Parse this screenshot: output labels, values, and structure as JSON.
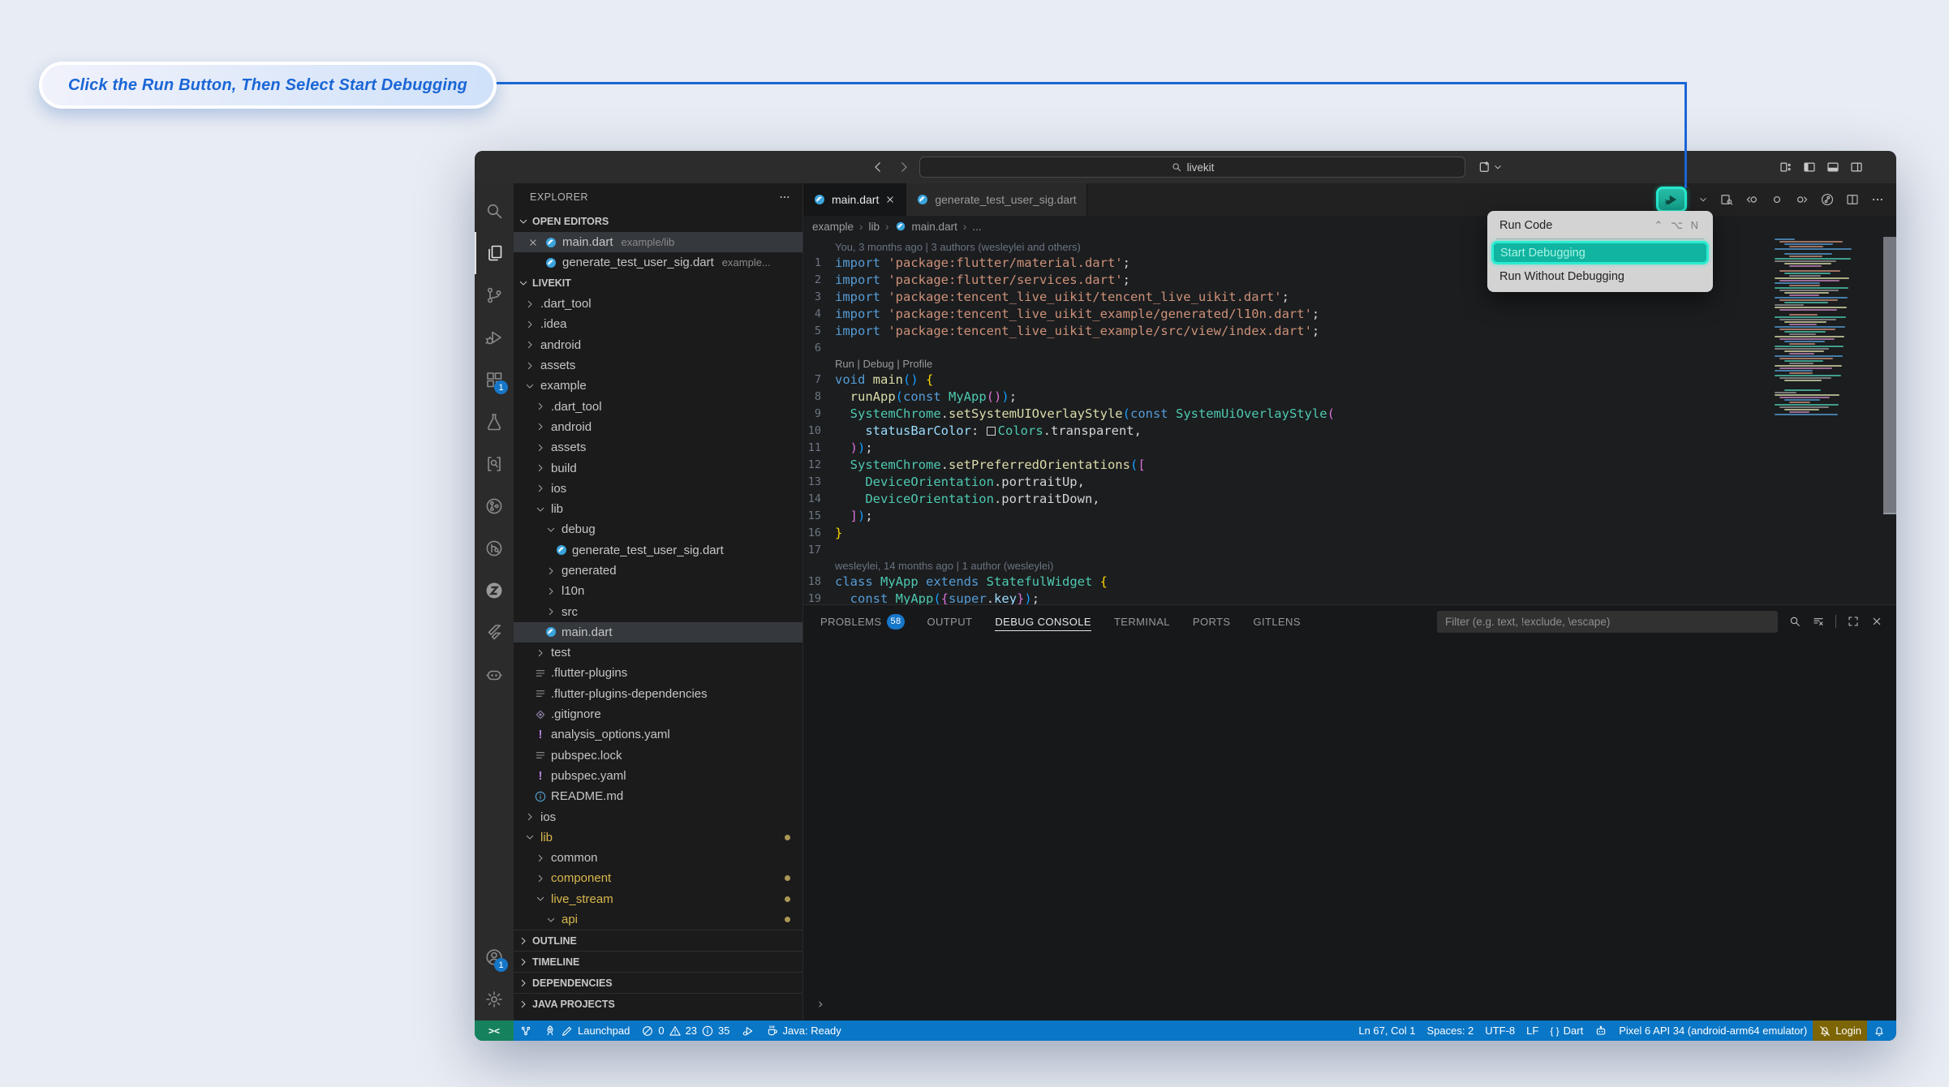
{
  "callout": {
    "text": "Click the Run Button, Then Select Start Debugging"
  },
  "titlebar": {
    "search_value": "livekit"
  },
  "activity_bar": {
    "items": [
      {
        "name": "search",
        "icon": "search"
      },
      {
        "name": "explorer",
        "icon": "files",
        "active": true
      },
      {
        "name": "source-control",
        "icon": "scm"
      },
      {
        "name": "run-and-debug",
        "icon": "debug"
      },
      {
        "name": "extensions",
        "icon": "extensions",
        "badge": "1"
      },
      {
        "name": "testing",
        "icon": "beaker"
      },
      {
        "name": "commit-search",
        "icon": "bracket-search"
      },
      {
        "name": "gitlens",
        "icon": "gitlens"
      },
      {
        "name": "gitlens-inspect",
        "icon": "gitlens-inspect"
      },
      {
        "name": "extension-z",
        "icon": "circle-z"
      },
      {
        "name": "flutter",
        "icon": "flutter"
      },
      {
        "name": "ai-assistant",
        "icon": "copilot"
      }
    ],
    "bottom_items": [
      {
        "name": "accounts",
        "icon": "account",
        "badge": "1"
      },
      {
        "name": "settings",
        "icon": "gear"
      }
    ]
  },
  "sidebar": {
    "title": "EXPLORER",
    "open_editors_label": "OPEN EDITORS",
    "open_editors": [
      {
        "name": "main.dart",
        "detail": "example/lib",
        "active": true
      },
      {
        "name": "generate_test_user_sig.dart",
        "detail": "example..."
      }
    ],
    "project_label": "LIVEKIT",
    "tree": [
      {
        "label": ".dart_tool",
        "indent": 0,
        "chev": "r"
      },
      {
        "label": ".idea",
        "indent": 0,
        "chev": "r"
      },
      {
        "label": "android",
        "indent": 0,
        "chev": "r"
      },
      {
        "label": "assets",
        "indent": 0,
        "chev": "r"
      },
      {
        "label": "example",
        "indent": 0,
        "chev": "d"
      },
      {
        "label": ".dart_tool",
        "indent": 1,
        "chev": "r"
      },
      {
        "label": "android",
        "indent": 1,
        "chev": "r"
      },
      {
        "label": "assets",
        "indent": 1,
        "chev": "r"
      },
      {
        "label": "build",
        "indent": 1,
        "chev": "r"
      },
      {
        "label": "ios",
        "indent": 1,
        "chev": "r"
      },
      {
        "label": "lib",
        "indent": 1,
        "chev": "d"
      },
      {
        "label": "debug",
        "indent": 2,
        "chev": "d"
      },
      {
        "label": "generate_test_user_sig.dart",
        "indent": 3,
        "icon": "dart"
      },
      {
        "label": "generated",
        "indent": 2,
        "chev": "r"
      },
      {
        "label": "l10n",
        "indent": 2,
        "chev": "r"
      },
      {
        "label": "src",
        "indent": 2,
        "chev": "r"
      },
      {
        "label": "main.dart",
        "indent": 2,
        "icon": "dart",
        "selected": true
      },
      {
        "label": "test",
        "indent": 1,
        "chev": "r"
      },
      {
        "label": ".flutter-plugins",
        "indent": 1,
        "icon": "list"
      },
      {
        "label": ".flutter-plugins-dependencies",
        "indent": 1,
        "icon": "list"
      },
      {
        "label": ".gitignore",
        "indent": 1,
        "icon": "git"
      },
      {
        "label": "analysis_options.yaml",
        "indent": 1,
        "icon": "yaml"
      },
      {
        "label": "pubspec.lock",
        "indent": 1,
        "icon": "list"
      },
      {
        "label": "pubspec.yaml",
        "indent": 1,
        "icon": "yaml"
      },
      {
        "label": "README.md",
        "indent": 1,
        "icon": "info"
      },
      {
        "label": "ios",
        "indent": 0,
        "chev": "r"
      },
      {
        "label": "lib",
        "indent": 0,
        "chev": "d",
        "mod": true,
        "dot": true
      },
      {
        "label": "common",
        "indent": 1,
        "chev": "r"
      },
      {
        "label": "component",
        "indent": 1,
        "chev": "r",
        "mod": true,
        "dot": true
      },
      {
        "label": "live_stream",
        "indent": 1,
        "chev": "d",
        "mod": true,
        "dot": true
      },
      {
        "label": "api",
        "indent": 2,
        "chev": "d",
        "mod": true,
        "dot": true
      }
    ],
    "bottom_sections": [
      "OUTLINE",
      "TIMELINE",
      "DEPENDENCIES",
      "JAVA PROJECTS"
    ]
  },
  "editor": {
    "tabs": [
      {
        "label": "main.dart",
        "active": true
      },
      {
        "label": "generate_test_user_sig.dart",
        "active": false
      }
    ],
    "breadcrumb": [
      "example",
      "lib",
      "main.dart",
      "..."
    ],
    "rows": [
      {
        "type": "blame",
        "text": "You, 3 months ago | 3 authors (wesleylei and others)"
      },
      {
        "type": "code",
        "n": "1",
        "tokens": [
          [
            "k",
            "import "
          ],
          [
            "s",
            "'package:flutter/material.dart'"
          ],
          [
            "p",
            ";"
          ]
        ]
      },
      {
        "type": "code",
        "n": "2",
        "tokens": [
          [
            "k",
            "import "
          ],
          [
            "s",
            "'package:flutter/services.dart'"
          ],
          [
            "p",
            ";"
          ]
        ]
      },
      {
        "type": "code",
        "n": "3",
        "tokens": [
          [
            "k",
            "import "
          ],
          [
            "s",
            "'package:tencent_live_uikit/tencent_live_uikit.dart'"
          ],
          [
            "p",
            ";"
          ]
        ]
      },
      {
        "type": "code",
        "n": "4",
        "tokens": [
          [
            "k",
            "import "
          ],
          [
            "s",
            "'package:tencent_live_uikit_example/generated/l10n.dart'"
          ],
          [
            "p",
            ";"
          ]
        ]
      },
      {
        "type": "code",
        "n": "5",
        "tokens": [
          [
            "k",
            "import "
          ],
          [
            "s",
            "'package:tencent_live_uikit_example/src/view/index.dart'"
          ],
          [
            "p",
            ";"
          ]
        ]
      },
      {
        "type": "code",
        "n": "6",
        "tokens": []
      },
      {
        "type": "lens",
        "text": "Run | Debug | Profile"
      },
      {
        "type": "code",
        "n": "7",
        "tokens": [
          [
            "k",
            "void "
          ],
          [
            "f",
            "main"
          ],
          [
            "b3",
            "()"
          ],
          [
            "p",
            " "
          ],
          [
            "b1",
            "{"
          ]
        ]
      },
      {
        "type": "code",
        "n": "8",
        "tokens": [
          [
            "p",
            "  "
          ],
          [
            "f",
            "runApp"
          ],
          [
            "b3",
            "("
          ],
          [
            "k",
            "const "
          ],
          [
            "t",
            "MyApp"
          ],
          [
            "b2",
            "()"
          ],
          [
            "b3",
            ")"
          ],
          [
            "p",
            ";"
          ]
        ]
      },
      {
        "type": "code",
        "n": "9",
        "tokens": [
          [
            "p",
            "  "
          ],
          [
            "t",
            "SystemChrome"
          ],
          [
            "p",
            "."
          ],
          [
            "f",
            "setSystemUIOverlayStyle"
          ],
          [
            "b3",
            "("
          ],
          [
            "k",
            "const "
          ],
          [
            "t",
            "SystemUiOverlayStyle"
          ],
          [
            "b2",
            "("
          ]
        ]
      },
      {
        "type": "code",
        "n": "10",
        "tokens": [
          [
            "p",
            "    "
          ],
          [
            "v",
            "statusBarColor"
          ],
          [
            "p",
            ": "
          ],
          [
            "w",
            ""
          ],
          [
            "t",
            "Colors"
          ],
          [
            "p",
            ".transparent,"
          ]
        ]
      },
      {
        "type": "code",
        "n": "11",
        "tokens": [
          [
            "p",
            "  "
          ],
          [
            "b2",
            ")"
          ],
          [
            "b3",
            ")"
          ],
          [
            "p",
            ";"
          ]
        ]
      },
      {
        "type": "code",
        "n": "12",
        "tokens": [
          [
            "p",
            "  "
          ],
          [
            "t",
            "SystemChrome"
          ],
          [
            "p",
            "."
          ],
          [
            "f",
            "setPreferredOrientations"
          ],
          [
            "b3",
            "("
          ],
          [
            "b2",
            "["
          ]
        ]
      },
      {
        "type": "code",
        "n": "13",
        "tokens": [
          [
            "p",
            "    "
          ],
          [
            "t",
            "DeviceOrientation"
          ],
          [
            "p",
            ".portraitUp,"
          ]
        ]
      },
      {
        "type": "code",
        "n": "14",
        "tokens": [
          [
            "p",
            "    "
          ],
          [
            "t",
            "DeviceOrientation"
          ],
          [
            "p",
            ".portraitDown,"
          ]
        ]
      },
      {
        "type": "code",
        "n": "15",
        "tokens": [
          [
            "p",
            "  "
          ],
          [
            "b2",
            "]"
          ],
          [
            "b3",
            ")"
          ],
          [
            "p",
            ";"
          ]
        ]
      },
      {
        "type": "code",
        "n": "16",
        "tokens": [
          [
            "b1",
            "}"
          ]
        ]
      },
      {
        "type": "code",
        "n": "17",
        "tokens": []
      },
      {
        "type": "blame",
        "text": "wesleylei, 14 months ago | 1 author (wesleylei)"
      },
      {
        "type": "code",
        "n": "18",
        "tokens": [
          [
            "k",
            "class "
          ],
          [
            "t",
            "MyApp"
          ],
          [
            "k",
            " extends "
          ],
          [
            "t",
            "StatefulWidget"
          ],
          [
            "p",
            " "
          ],
          [
            "b1",
            "{"
          ]
        ]
      },
      {
        "type": "code",
        "n": "19",
        "tokens": [
          [
            "p",
            "  "
          ],
          [
            "k",
            "const "
          ],
          [
            "t",
            "MyApp"
          ],
          [
            "b3",
            "("
          ],
          [
            "b2",
            "{"
          ],
          [
            "k",
            "super"
          ],
          [
            "p",
            "."
          ],
          [
            "v",
            "key"
          ],
          [
            "b2",
            "}"
          ],
          [
            "b3",
            ")"
          ],
          [
            "p",
            ";"
          ]
        ]
      }
    ],
    "toolbar_icons": [
      "preview-search",
      "prev-change",
      "change",
      "next-change",
      "graph-circle",
      "split",
      "ellipsis"
    ]
  },
  "run_dropdown": {
    "items": [
      {
        "label": "Run Code",
        "shortcut": "⌃ ⌥ N"
      },
      {
        "label": "Start Debugging",
        "highlighted": true
      },
      {
        "label": "Run Without Debugging"
      }
    ]
  },
  "panel": {
    "tabs": [
      {
        "label": "PROBLEMS",
        "badge": "58"
      },
      {
        "label": "OUTPUT"
      },
      {
        "label": "DEBUG CONSOLE",
        "active": true
      },
      {
        "label": "TERMINAL"
      },
      {
        "label": "PORTS"
      },
      {
        "label": "GITLENS"
      }
    ],
    "filter_placeholder": "Filter (e.g. text, !exclude, \\escape)",
    "prompt": "›"
  },
  "status_bar": {
    "left": [
      {
        "name": "remote-indicator",
        "icon": "remote",
        "style": "remote"
      },
      {
        "name": "commit-graph",
        "icon": "graph"
      },
      {
        "name": "launchpad",
        "icons": [
          "rocket",
          "pen"
        ],
        "label": "Launchpad"
      },
      {
        "name": "problems-summary",
        "parts": [
          [
            "error",
            "0"
          ],
          [
            "warning",
            "23"
          ],
          [
            "info",
            "35"
          ]
        ]
      },
      {
        "name": "debug-launch",
        "icon": "debug-alt"
      },
      {
        "name": "java-status",
        "icon": "coffee",
        "label": "Java: Ready"
      }
    ],
    "right": [
      {
        "name": "cursor-position",
        "label": "Ln 67, Col 1"
      },
      {
        "name": "indentation",
        "label": "Spaces: 2"
      },
      {
        "name": "encoding",
        "label": "UTF-8"
      },
      {
        "name": "eol",
        "label": "LF"
      },
      {
        "name": "language-mode",
        "icon": "braces",
        "label": "Dart"
      },
      {
        "name": "assistant-status",
        "icon": "robot"
      },
      {
        "name": "device-selector",
        "label": "Pixel 6 API 34 (android-arm64 emulator)"
      },
      {
        "name": "login",
        "icon": "bell-slash",
        "label": "Login",
        "style": "warn"
      },
      {
        "name": "notifications",
        "icon": "bell"
      }
    ]
  }
}
